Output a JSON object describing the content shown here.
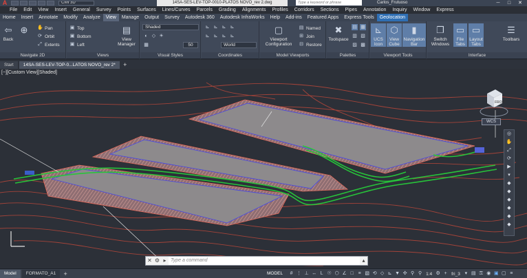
{
  "title_bar": {
    "app_logo": "A",
    "workspace": "Civil 3D",
    "document_title": "14SA-SES-LEV-TOP-0010-PLATOS NOVO_rev 2.dwg",
    "search_placeholder": "Type a keyword or phrase",
    "user_name": "Carlos_Frutuoso"
  },
  "menu_bar": [
    "File",
    "Edit",
    "View",
    "Insert",
    "General",
    "Survey",
    "Points",
    "Surfaces",
    "Lines/Curves",
    "Parcels",
    "Grading",
    "Alignments",
    "Profiles",
    "Corridors",
    "Sections",
    "Pipes",
    "Annotation",
    "Inquiry",
    "Window",
    "Express"
  ],
  "ribbon_tabs": [
    "Home",
    "Insert",
    "Annotate",
    "Modify",
    "Analyze",
    "View",
    "Manage",
    "Output",
    "Survey",
    "Autodesk 360",
    "Autodesk InfraWorks",
    "Help",
    "Add-ins",
    "Featured Apps",
    "Express Tools",
    "Geolocation"
  ],
  "active_ribbon_tab": "View",
  "ribbon": {
    "navigate": {
      "label": "Navigate 2D",
      "back": "Back",
      "pan": "Pan",
      "orbit": "Orbit",
      "extents": "Extents"
    },
    "views": {
      "label": "Views",
      "top": "Top",
      "bottom": "Bottom",
      "left": "Left",
      "view_manager": "View\nManager"
    },
    "visual_styles": {
      "label": "Visual Styles",
      "style": "Shaded",
      "opacity": "50"
    },
    "coordinates": {
      "label": "Coordinates",
      "ucs": "World"
    },
    "model_viewports": {
      "label": "Model Viewports",
      "viewport_configuration": "Viewport\nConfiguration",
      "named": "Named",
      "join": "Join",
      "restore": "Restore"
    },
    "palettes": {
      "label": "Palettes",
      "toolspace": "Toolspace"
    },
    "viewport_tools": {
      "label": "Viewport Tools",
      "ucs_icon": "UCS\nIcon",
      "view_cube": "View\nCube",
      "navigation_bar": "Navigation\nBar"
    },
    "interface": {
      "label": "Interface",
      "switch_windows": "Switch\nWindows",
      "file_tabs": "File\nTabs",
      "layout_tabs": "Layout\nTabs",
      "toolbars": "Toolbars"
    }
  },
  "file_tabs": [
    "Start",
    "14SA-SES-LEV-TOP-0...LATOS NOVO_rev 2*"
  ],
  "viewport": {
    "label": "[−][Custom View][Shaded]",
    "viewcube_face": "FRONT",
    "wcs": "WCS"
  },
  "command_line": {
    "placeholder": "Type a command"
  },
  "layout_tabs": [
    "Model",
    "FORMATO_A1"
  ],
  "status_bar": {
    "space": "MODEL",
    "scale": "1:4",
    "layer": "fri_3"
  },
  "colors": {
    "ribbon_bg": "#404959",
    "viewport_bg": "#2c3038",
    "geolocation_tab": "#2f6fb4",
    "contour": "#d24a3a",
    "road": "#27c43a",
    "platform": "#8d8a8c",
    "hatch": "#e0a7a0"
  }
}
